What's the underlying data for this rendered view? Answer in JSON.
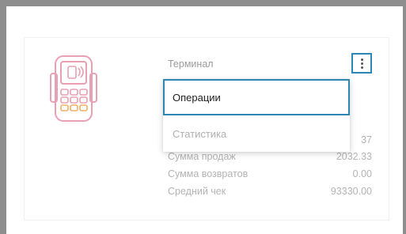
{
  "card": {
    "title": "Терминал"
  },
  "menu": {
    "button_icon": "more-vertical-icon",
    "items": [
      {
        "label": "Операции",
        "state": "highlighted"
      },
      {
        "label": "Статистика",
        "state": "normal"
      }
    ]
  },
  "stats": [
    {
      "label": "",
      "value": "37"
    },
    {
      "label": "Сумма продаж",
      "value": "2032.33"
    },
    {
      "label": "Сумма возвратов",
      "value": "0.00"
    },
    {
      "label": "Средний чек",
      "value": "93330.00"
    }
  ],
  "colors": {
    "accent": "#2e86b5",
    "icon_pink": "#e8a0b4",
    "icon_orange": "#f0b066",
    "frame": "#8e8e8e"
  }
}
